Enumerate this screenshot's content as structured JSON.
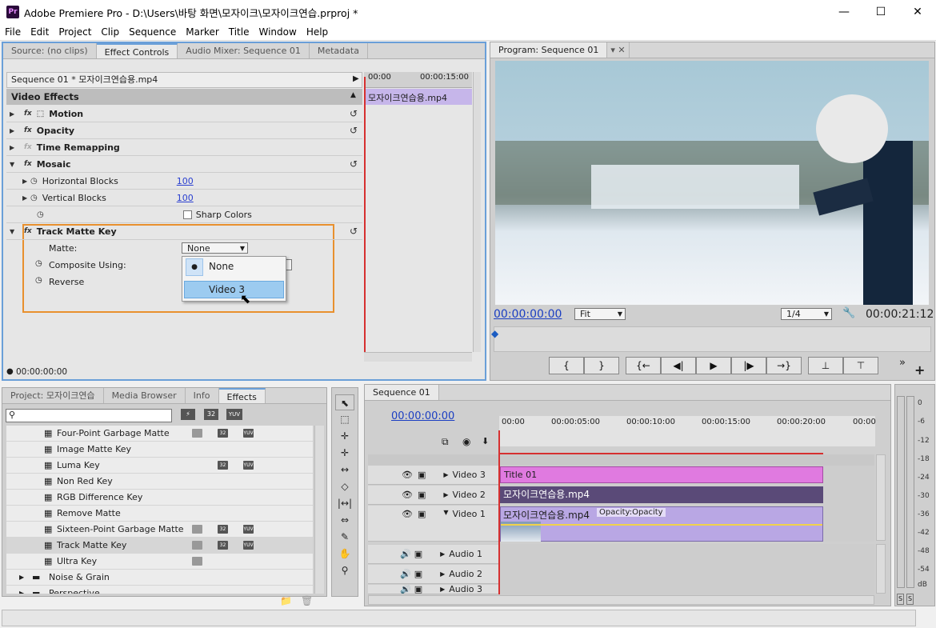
{
  "window": {
    "title": "Adobe Premiere Pro - D:\\Users\\바탕 화면\\모자이크\\모자이크연습.prproj *",
    "icon": "Pr"
  },
  "menu": [
    "File",
    "Edit",
    "Project",
    "Clip",
    "Sequence",
    "Marker",
    "Title",
    "Window",
    "Help"
  ],
  "left_top_tabs": [
    "Source: (no clips)",
    "Effect Controls",
    "Audio Mixer: Sequence 01",
    "Metadata"
  ],
  "effect_controls": {
    "sequence_label": "Sequence 01 * 모자이크연습용.mp4",
    "time_start": "00:00",
    "time_mid": "00:00:15:00",
    "clip_name": "모자이크연습용.mp4",
    "section": "Video Effects",
    "rows": {
      "motion": "Motion",
      "opacity": "Opacity",
      "time_remap": "Time Remapping",
      "mosaic": "Mosaic",
      "hblocks": "Horizontal Blocks",
      "hblocks_val": "100",
      "vblocks": "Vertical Blocks",
      "vblocks_val": "100",
      "sharp": "Sharp Colors",
      "tmk": "Track Matte Key",
      "matte": "Matte:",
      "matte_val": "None",
      "composite": "Composite Using:",
      "reverse": "Reverse"
    },
    "menu_options": [
      "None",
      "Video 3"
    ],
    "timecode": "00:00:00:00"
  },
  "program": {
    "tab": "Program: Sequence 01",
    "timecode_left": "00:00:00:00",
    "fit": "Fit",
    "res": "1/4",
    "timecode_right": "00:00:21:12"
  },
  "transport": [
    "{",
    "}",
    "{←",
    "◀|",
    "▶",
    "|▶",
    "→}",
    "⊥",
    "⊤"
  ],
  "project_tabs": [
    "Project: 모자이크연습",
    "Media Browser",
    "Info",
    "Effects"
  ],
  "effects_list": [
    "Four-Point Garbage Matte",
    "Image Matte Key",
    "Luma Key",
    "Non Red Key",
    "RGB Difference Key",
    "Remove Matte",
    "Sixteen-Point Garbage Matte",
    "Track Matte Key",
    "Ultra Key"
  ],
  "effects_folders": [
    "Noise & Grain",
    "Perspective"
  ],
  "badges": {
    "a": "32",
    "b": "YUV"
  },
  "sequence": {
    "tab": "Sequence 01",
    "timecode": "00:00:00:00",
    "ruler": [
      "00:00",
      "00:00:05:00",
      "00:00:10:00",
      "00:00:15:00",
      "00:00:20:00",
      "00:00"
    ],
    "video_tracks": [
      "Video 3",
      "Video 2",
      "Video 1"
    ],
    "audio_tracks": [
      "Audio 1",
      "Audio 2",
      "Audio 3"
    ],
    "clips": {
      "title": "Title 01",
      "v2": "모자이크연습용.mp4",
      "v1": "모자이크연습용.mp4",
      "v1_fx": "Opacity:Opacity"
    }
  },
  "meter": [
    "0",
    "-6",
    "-12",
    "-18",
    "-24",
    "-30",
    "-36",
    "-42",
    "-48",
    "-54",
    "dB"
  ],
  "meter_btns": [
    "S",
    "S"
  ],
  "colors": {
    "accent": "#6a9fd8",
    "highlight_orange": "#e8902e",
    "title_clip": "#e07ae0",
    "v2_clip": "#5a4a78",
    "v1_clip": "#a890d8",
    "playhead": "#d63030"
  }
}
